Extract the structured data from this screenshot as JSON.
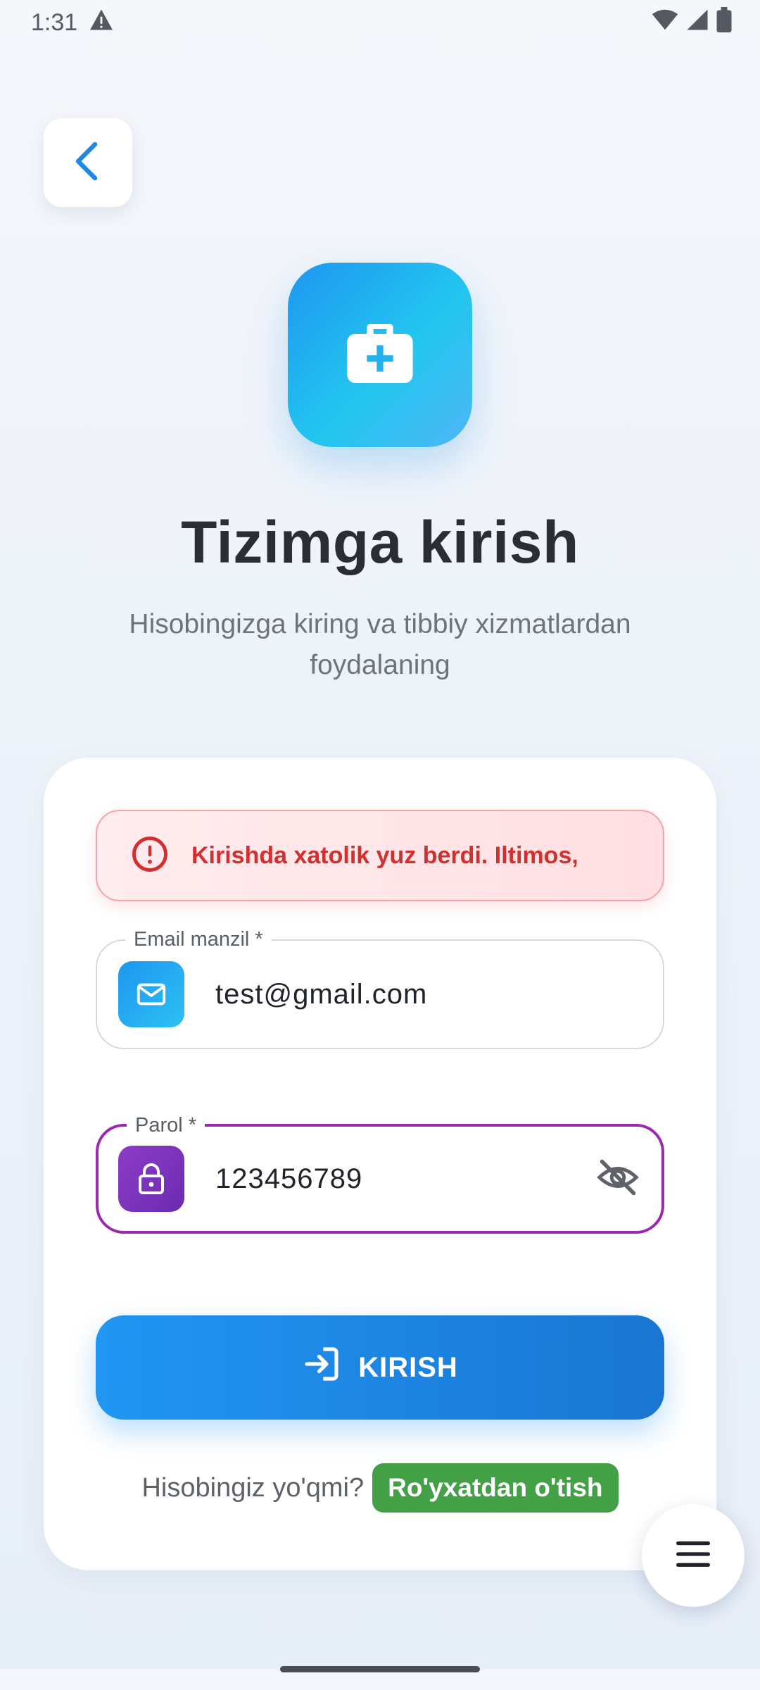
{
  "status_bar": {
    "time": "1:31",
    "icons": [
      "warning-icon",
      "wifi-icon",
      "signal-icon",
      "battery-icon"
    ]
  },
  "nav": {
    "back_icon": "chevron-left-icon"
  },
  "header": {
    "logo_icon": "medical-kit-icon",
    "title": "Tizimga kirish",
    "subtitle": "Hisobingizga kiring va tibbiy xizmatlardan foydalaning"
  },
  "form": {
    "error": {
      "icon": "error-circle-icon",
      "message": "Kirishda xatolik yuz berdi. Iltimos,"
    },
    "email": {
      "label": "Email manzil *",
      "value": "test@gmail.com",
      "icon": "mail-icon"
    },
    "password": {
      "label": "Parol *",
      "value": "123456789",
      "icon": "lock-icon",
      "toggle_icon": "eye-off-icon"
    },
    "submit": {
      "label": "KIRISH",
      "icon": "login-icon"
    },
    "signup": {
      "prompt": "Hisobingiz yo'qmi?",
      "link": "Ro'yxatdan o'tish"
    }
  },
  "fab": {
    "icon": "menu-icon"
  },
  "colors": {
    "primary": "#2196f3",
    "error": "#d32f2f",
    "focus": "#9c27b0",
    "success": "#43a047"
  }
}
